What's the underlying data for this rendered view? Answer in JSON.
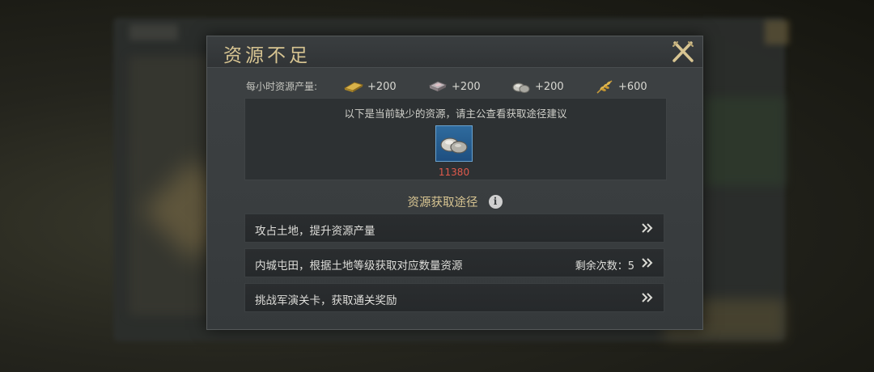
{
  "dialog": {
    "title": "资源不足",
    "hourly_label": "每小时资源产量:",
    "resources": [
      {
        "icon": "gold-bar-icon",
        "amount": "+200"
      },
      {
        "icon": "iron-ingot-icon",
        "amount": "+200"
      },
      {
        "icon": "stone-icon",
        "amount": "+200"
      },
      {
        "icon": "grain-icon",
        "amount": "+600"
      }
    ],
    "shortage_hint": "以下是当前缺少的资源，请主公查看获取途径建议",
    "shortage_item": {
      "icon": "stone-icon",
      "amount": "11380",
      "amount_color": "#e05a4c"
    },
    "path_title": "资源获取途径",
    "info_glyph": "i",
    "paths": [
      {
        "label": "攻占土地，提升资源产量",
        "remaining": ""
      },
      {
        "label": "内城屯田，根据土地等级获取对应数量资源",
        "remaining": "剩余次数：5"
      },
      {
        "label": "挑战军演关卡，获取通关奖励",
        "remaining": ""
      }
    ]
  },
  "colors": {
    "title_gold": "#d8c592",
    "shortage_red": "#e05a4c",
    "item_blue": "#2f6b9e"
  }
}
